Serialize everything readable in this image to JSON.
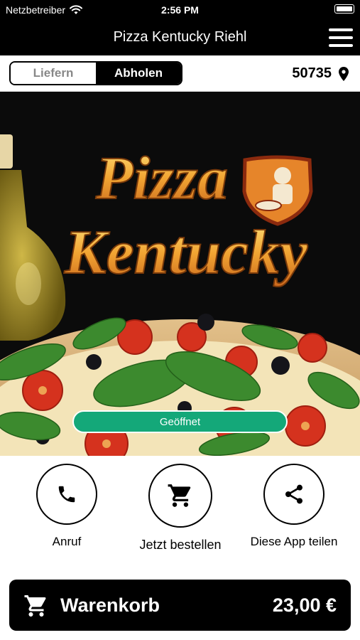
{
  "status_bar": {
    "carrier": "Netzbetreiber",
    "time": "2:56 PM"
  },
  "header": {
    "title": "Pizza Kentucky Riehl"
  },
  "mode_toggle": {
    "options": [
      "Liefern",
      "Abholen"
    ],
    "selected": "Abholen"
  },
  "location": {
    "zip": "50735"
  },
  "hero": {
    "logo_line1": "Pizza",
    "logo_line2": "Kentucky",
    "status_badge": "Geöffnet"
  },
  "actions": [
    {
      "label": "Anruf",
      "icon": "phone-icon"
    },
    {
      "label": "Jetzt bestellen",
      "icon": "cart-icon"
    },
    {
      "label": "Diese App teilen",
      "icon": "share-icon"
    }
  ],
  "cart": {
    "label": "Warenkorb",
    "total": "23,00 €"
  },
  "colors": {
    "bar": "#000000",
    "open_badge": "#14a879",
    "logo_gold": "#f2a533"
  }
}
